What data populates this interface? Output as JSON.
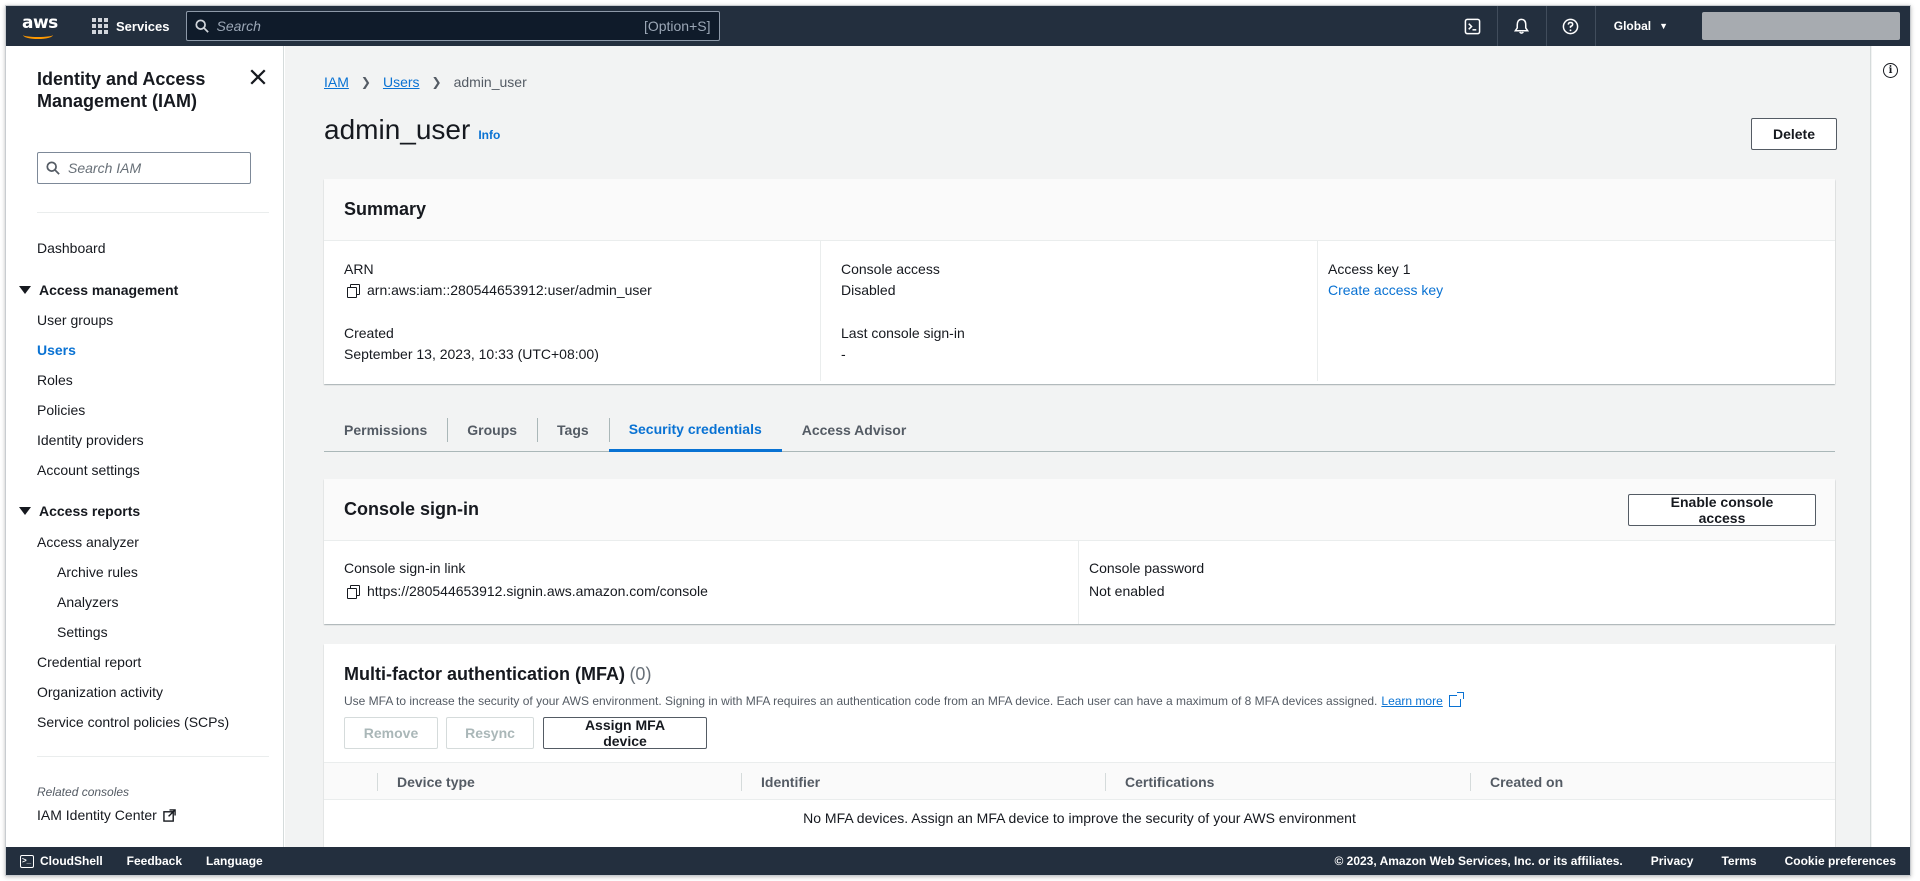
{
  "topnav": {
    "logo_text": "aws",
    "services_label": "Services",
    "search_placeholder": "Search",
    "search_shortcut": "[Option+S]",
    "region": "Global"
  },
  "sidebar": {
    "title": "Identity and Access Management (IAM)",
    "search_placeholder": "Search IAM",
    "dashboard": "Dashboard",
    "access_management": {
      "label": "Access management",
      "items": [
        "User groups",
        "Users",
        "Roles",
        "Policies",
        "Identity providers",
        "Account settings"
      ],
      "active": "Users"
    },
    "access_reports": {
      "label": "Access reports",
      "items": [
        "Access analyzer",
        "Archive rules",
        "Analyzers",
        "Settings",
        "Credential report",
        "Organization activity",
        "Service control policies (SCPs)"
      ]
    },
    "related_label": "Related consoles",
    "related_item": "IAM Identity Center"
  },
  "breadcrumb": [
    "IAM",
    "Users",
    "admin_user"
  ],
  "page": {
    "title": "admin_user",
    "info_label": "Info",
    "delete_button": "Delete"
  },
  "summary": {
    "header": "Summary",
    "arn_label": "ARN",
    "arn_value": "arn:aws:iam::280544653912:user/admin_user",
    "created_label": "Created",
    "created_value": "September 13, 2023, 10:33 (UTC+08:00)",
    "console_access_label": "Console access",
    "console_access_value": "Disabled",
    "last_signin_label": "Last console sign-in",
    "last_signin_value": "-",
    "access_key_label": "Access key 1",
    "access_key_link": "Create access key"
  },
  "tabs": [
    "Permissions",
    "Groups",
    "Tags",
    "Security credentials",
    "Access Advisor"
  ],
  "active_tab": "Security credentials",
  "console_signin": {
    "header": "Console sign-in",
    "enable_button": "Enable console access",
    "link_label": "Console sign-in link",
    "link_value": "https://280544653912.signin.aws.amazon.com/console",
    "password_label": "Console password",
    "password_value": "Not enabled"
  },
  "mfa": {
    "title": "Multi-factor authentication (MFA)",
    "count": "(0)",
    "description": "Use MFA to increase the security of your AWS environment. Signing in with MFA requires an authentication code from an MFA device. Each user can have a maximum of 8 MFA devices assigned.",
    "learn_more": "Learn more",
    "remove_button": "Remove",
    "resync_button": "Resync",
    "assign_button": "Assign MFA device",
    "columns": [
      "Device type",
      "Identifier",
      "Certifications",
      "Created on"
    ],
    "empty_message": "No MFA devices. Assign an MFA device to improve the security of your AWS environment"
  },
  "footer": {
    "cloudshell": "CloudShell",
    "feedback": "Feedback",
    "language": "Language",
    "copyright": "© 2023, Amazon Web Services, Inc. or its affiliates.",
    "privacy": "Privacy",
    "terms": "Terms",
    "cookie": "Cookie preferences"
  },
  "colors": {
    "nav_bg": "#232f3e",
    "link_blue": "#0972d3",
    "aws_orange": "#ff9900",
    "page_bg": "#f2f3f3"
  }
}
